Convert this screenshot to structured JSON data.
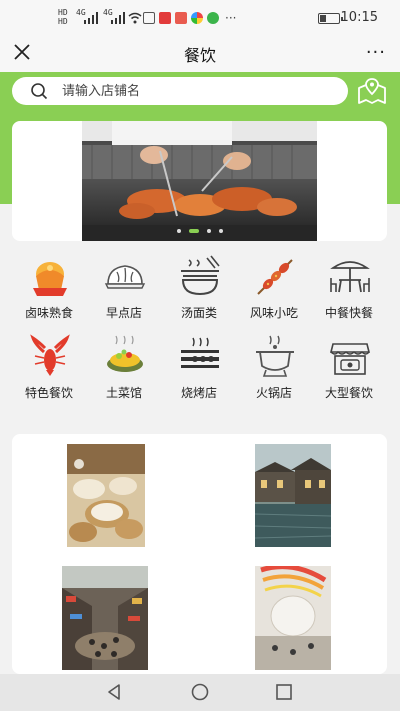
{
  "status_bar": {
    "sim1": "HD",
    "sim2": "HD",
    "net1": "4G",
    "net2": "4G",
    "time": "10:15",
    "battery_percent": 35,
    "more_label": "···"
  },
  "nav": {
    "title": "餐饮",
    "more_label": "···"
  },
  "search": {
    "placeholder": "请输入店铺名"
  },
  "banner": {
    "dot_count": 4,
    "active_dot": 1
  },
  "categories": [
    {
      "label": "卤味熟食",
      "icon": "braised-food-icon"
    },
    {
      "label": "早点店",
      "icon": "steamed-bun-icon"
    },
    {
      "label": "汤面类",
      "icon": "noodle-bowl-icon"
    },
    {
      "label": "风味小吃",
      "icon": "skewer-icon"
    },
    {
      "label": "中餐快餐",
      "icon": "dining-table-icon"
    },
    {
      "label": "特色餐饮",
      "icon": "crayfish-icon"
    },
    {
      "label": "土菜馆",
      "icon": "dish-icon"
    },
    {
      "label": "烧烤店",
      "icon": "bbq-grill-icon"
    },
    {
      "label": "火锅店",
      "icon": "hotpot-icon"
    },
    {
      "label": "大型餐饮",
      "icon": "restaurant-storefront-icon"
    }
  ],
  "colors": {
    "accent_green": "#8acf54",
    "background": "#f2f2f2"
  }
}
